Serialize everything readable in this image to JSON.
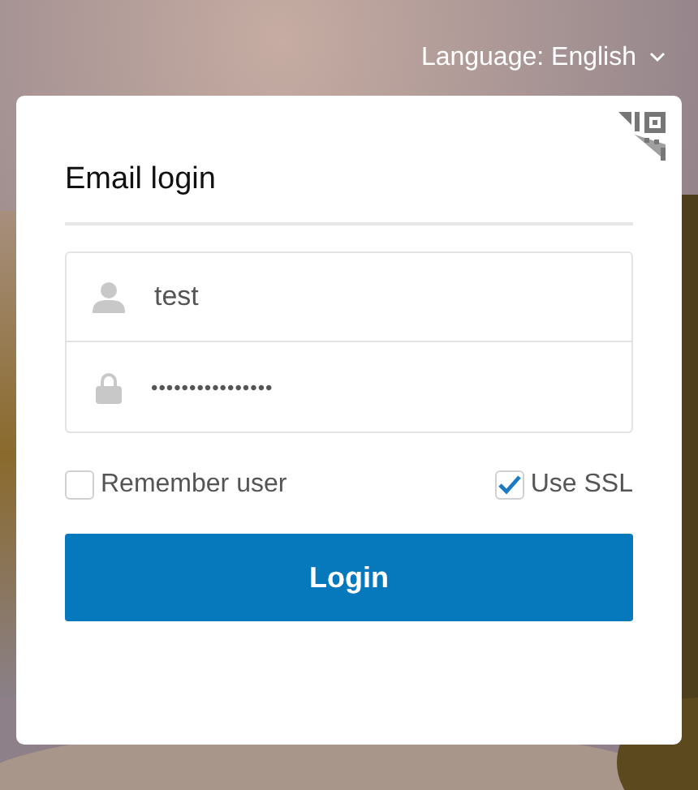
{
  "language": {
    "label": "Language: English"
  },
  "title": "Email login",
  "username": {
    "value": "test"
  },
  "password": {
    "value": "••••••••••••••••"
  },
  "options": [
    {
      "label": "Remember user",
      "checked": false
    },
    {
      "label": "Use SSL",
      "checked": true
    }
  ],
  "login_button": "Login"
}
